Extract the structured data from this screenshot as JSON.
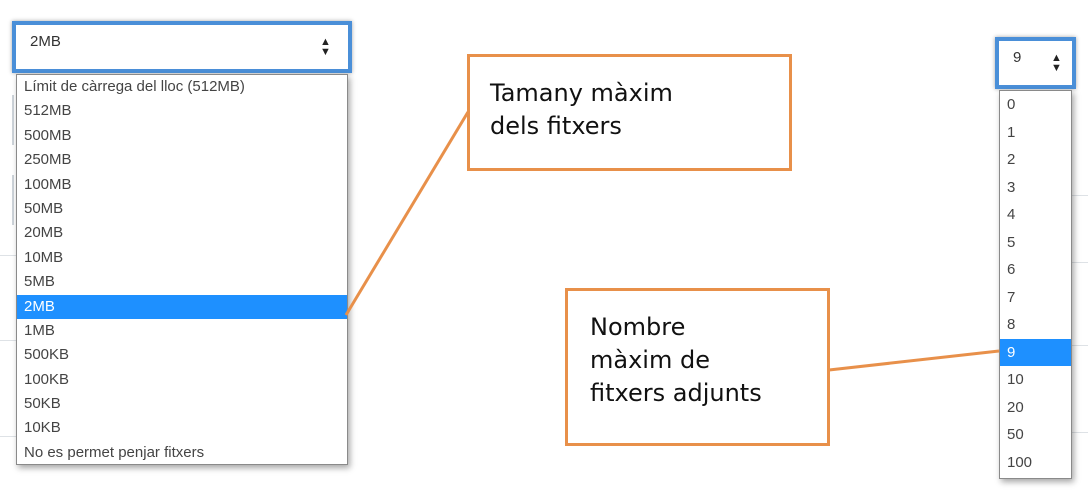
{
  "left_select": {
    "value": "2MB",
    "options": [
      "Límit de càrrega del lloc (512MB)",
      "512MB",
      "500MB",
      "250MB",
      "100MB",
      "50MB",
      "20MB",
      "10MB",
      "5MB",
      "2MB",
      "1MB",
      "500KB",
      "100KB",
      "50KB",
      "10KB",
      "No es permet penjar fitxers"
    ],
    "selected_index": 9
  },
  "right_select": {
    "value": "9",
    "options": [
      "0",
      "1",
      "2",
      "3",
      "4",
      "5",
      "6",
      "7",
      "8",
      "9",
      "10",
      "20",
      "50",
      "100"
    ],
    "selected_index": 9
  },
  "callouts": {
    "size": {
      "line1": "Tamany màxim",
      "line2": "dels fitxers"
    },
    "count": {
      "line1": "Nombre",
      "line2": "màxim de",
      "line3": "fitxers adjunts"
    }
  },
  "icons": {
    "select_arrows": "sort-arrows-icon"
  },
  "colors": {
    "select_border": "#4a8fd8",
    "highlight": "#1e90ff",
    "callout_border": "#e8904a"
  }
}
